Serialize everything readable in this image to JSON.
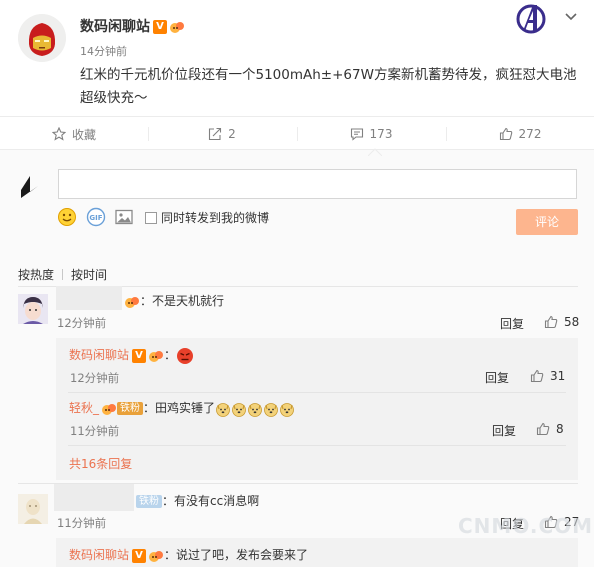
{
  "post": {
    "author": "数码闲聊站",
    "verified_badge": "V",
    "time": "14分钟前",
    "text": "红米的千元机价位段还有一个5100mAh±+67W方案新机蓄势待发，疯狂怼大电池超级快充～"
  },
  "actions": {
    "favorite_label": "收藏",
    "repost_count": "2",
    "comment_count": "173",
    "like_count": "272"
  },
  "composer": {
    "input_value": "",
    "repost_label": "同时转发到我的微博",
    "submit_label": "评论"
  },
  "sort": {
    "hot_label": "按热度",
    "time_label": "按时间"
  },
  "comments": [
    {
      "text": "：不是天机就行",
      "time": "12分钟前",
      "reply_label": "回复",
      "likes": "58",
      "replies": [
        {
          "author": "数码闲聊站",
          "text": "：",
          "time": "12分钟前",
          "reply_label": "回复",
          "likes": "31"
        },
        {
          "author": "轻秋_",
          "badge": "铁粉",
          "text": "：田鸡实锤了",
          "time": "11分钟前",
          "reply_label": "回复",
          "likes": "8"
        }
      ],
      "more_replies": "共16条回复"
    },
    {
      "badge": "铁粉",
      "text": "：有没有cc消息啊",
      "time": "11分钟前",
      "reply_label": "回复",
      "likes": "27",
      "replies": [
        {
          "author": "数码闲聊站",
          "text": "：说过了吧，发布会要来了"
        }
      ]
    }
  ],
  "watermark": "CNMO.COM",
  "colors": {
    "accent": "#eb7350",
    "verified": "#ff8200",
    "submit_disabled": "#fdb58e"
  }
}
